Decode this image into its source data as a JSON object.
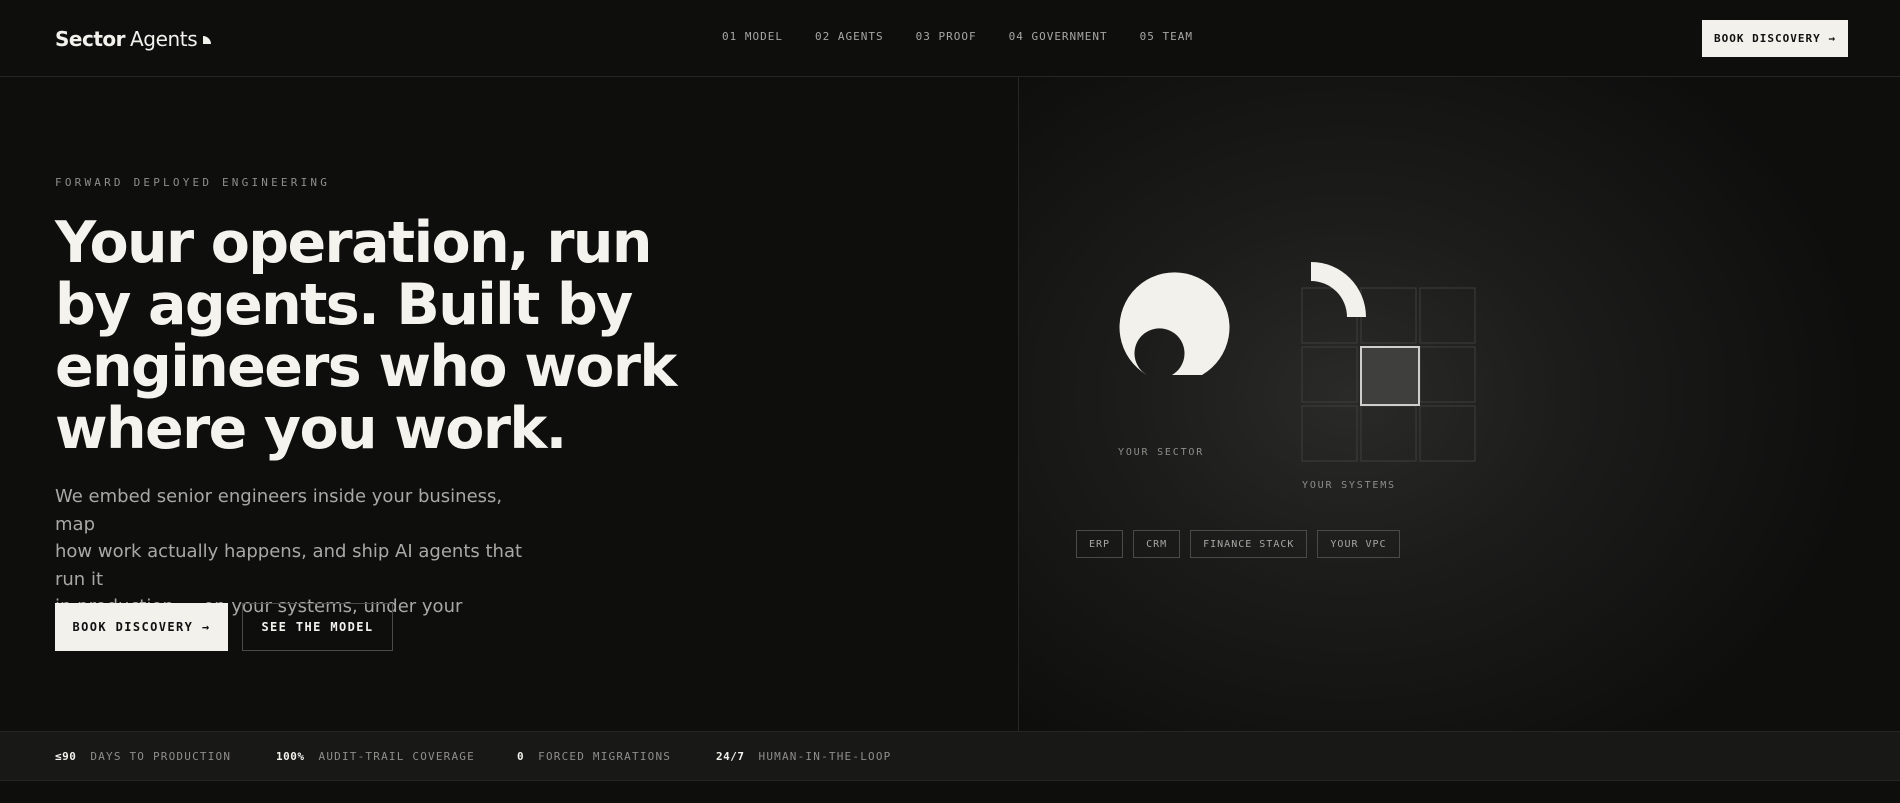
{
  "brand": {
    "word1": "Sector",
    "word2": "Agents"
  },
  "nav": {
    "items": [
      {
        "label": "01 MODEL"
      },
      {
        "label": "02 AGENTS"
      },
      {
        "label": "03 PROOF"
      },
      {
        "label": "04 GOVERNMENT"
      },
      {
        "label": "05 TEAM"
      }
    ],
    "cta_label": "BOOK DISCOVERY →"
  },
  "hero": {
    "eyebrow": "FORWARD DEPLOYED ENGINEERING",
    "headline_lines": [
      "Your operation, run",
      "by agents. Built by",
      "engineers who work",
      "where you work."
    ],
    "lede_lines": [
      "We embed senior engineers inside your business, map",
      "how work actually happens, and ship AI agents that run it",
      "in production — on your systems, under your control."
    ],
    "primary_cta": "BOOK DISCOVERY →",
    "secondary_cta": "SEE THE MODEL"
  },
  "diagram": {
    "sector_caption": "YOUR SECTOR",
    "systems_caption": "YOUR SYSTEMS",
    "tags": [
      "ERP",
      "CRM",
      "FINANCE STACK",
      "YOUR VPC"
    ]
  },
  "stats": [
    {
      "value": "≤90",
      "label": "DAYS TO PRODUCTION"
    },
    {
      "value": "100%",
      "label": "AUDIT-TRAIL COVERAGE"
    },
    {
      "value": "0",
      "label": "FORCED MIGRATIONS"
    },
    {
      "value": "24/7",
      "label": "HUMAN-IN-THE-LOOP"
    }
  ],
  "colors": {
    "background": "#0e0e0d",
    "text": "#f2f1ec",
    "muted": "#8f8e89",
    "border": "#262624"
  }
}
